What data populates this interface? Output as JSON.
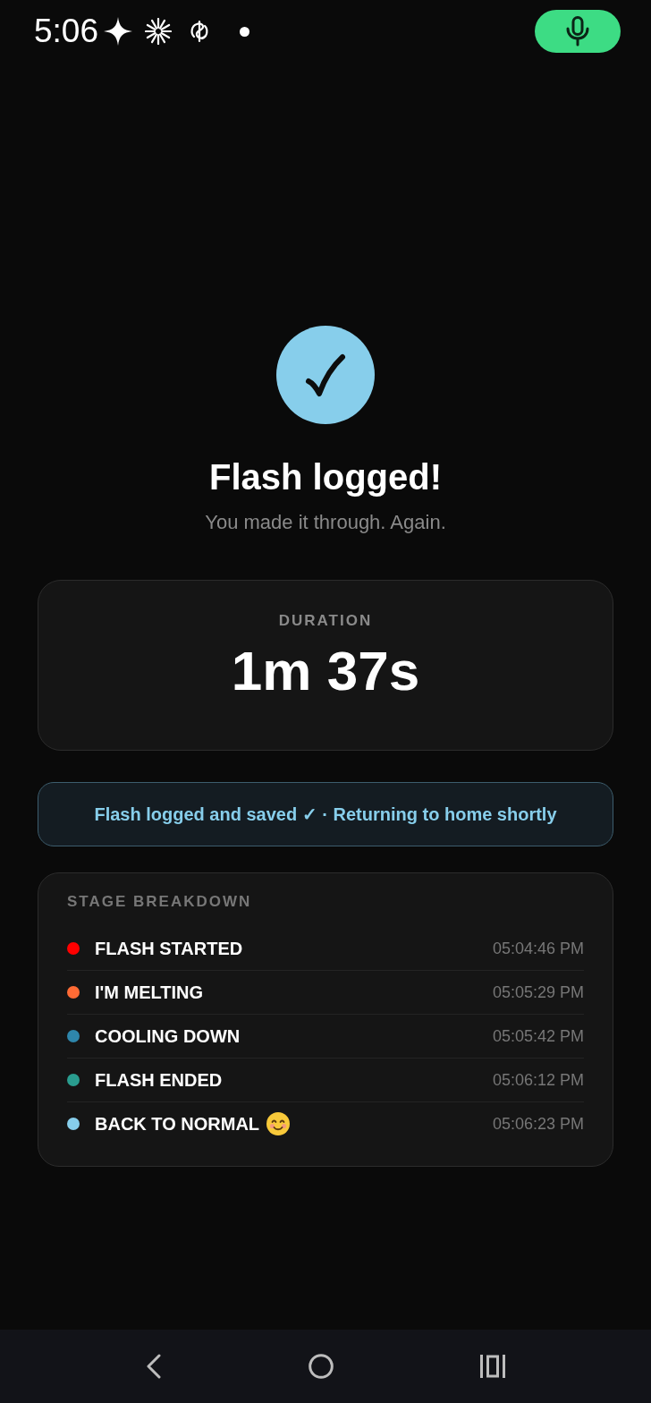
{
  "status_bar": {
    "time": "5:06"
  },
  "header": {
    "title": "Flash logged!",
    "subtitle": "You made it through. Again."
  },
  "duration": {
    "label": "DURATION",
    "value": "1m 37s"
  },
  "banner": {
    "text": "Flash logged and saved ✓ · Returning to home shortly"
  },
  "stage_breakdown": {
    "title": "STAGE BREAKDOWN",
    "stages": [
      {
        "label": "FLASH STARTED",
        "time": "05:04:46 PM",
        "color": "#ff0000",
        "kind": "plain"
      },
      {
        "label": "I'M MELTING",
        "time": "05:05:29 PM",
        "color": "#ff6b35",
        "kind": "plain"
      },
      {
        "label": "COOLING DOWN",
        "time": "05:05:42 PM",
        "color": "#2e86ab",
        "kind": "plain"
      },
      {
        "label": "FLASH ENDED",
        "time": "05:06:12 PM",
        "color": "#2a9d8f",
        "kind": "plain"
      },
      {
        "label": "BACK TO NORMAL",
        "time": "05:06:23 PM",
        "color": "#87ceeb",
        "kind": "emoji"
      }
    ]
  }
}
